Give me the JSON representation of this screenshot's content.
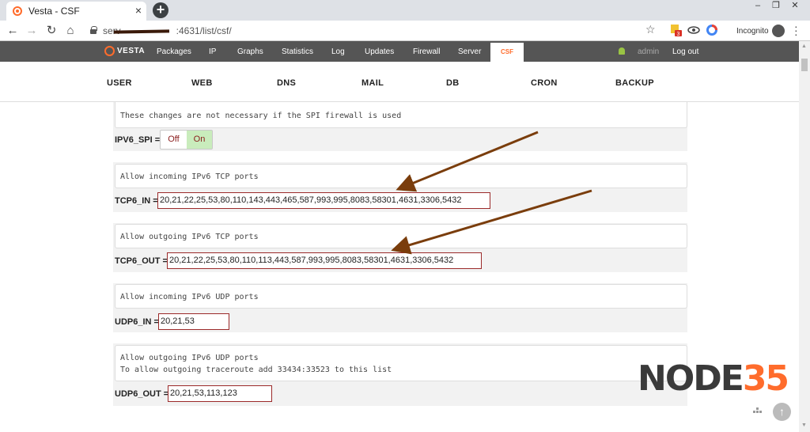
{
  "browser": {
    "tab_title": "Vesta - CSF",
    "tab_close": "×",
    "new_tab": "+",
    "url_prefix": "serv",
    "url_suffix": ":4631/list/csf/",
    "incognito_label": "Incognito",
    "window_controls": [
      "–",
      "❐",
      "✕"
    ],
    "extension_badge": "3"
  },
  "topnav": {
    "logo": "VESTA",
    "items": [
      "Packages",
      "IP",
      "Graphs",
      "Statistics",
      "Log",
      "Updates",
      "Firewall",
      "Server",
      "CSF"
    ],
    "active": "CSF",
    "user": "admin",
    "logout": "Log out"
  },
  "subnav": {
    "items": [
      "USER",
      "WEB",
      "DNS",
      "MAIL",
      "DB",
      "CRON",
      "BACKUP"
    ]
  },
  "config": {
    "spi_comment": "These changes are not necessary if the SPI firewall is used",
    "ipv6_spi": {
      "label": "IPV6_SPI =",
      "off": "Off",
      "on": "On",
      "selected": "On"
    },
    "tcp6_in_comment": "Allow incoming IPv6 TCP ports",
    "tcp6_in": {
      "label": "TCP6_IN =",
      "value": "20,21,22,25,53,80,110,143,443,465,587,993,995,8083,58301,4631,3306,5432"
    },
    "tcp6_out_comment": "Allow outgoing IPv6 TCP ports",
    "tcp6_out": {
      "label": "TCP6_OUT =",
      "value": "20,21,22,25,53,80,110,113,443,587,993,995,8083,58301,4631,3306,5432"
    },
    "udp6_in_comment": "Allow incoming IPv6 UDP ports",
    "udp6_in": {
      "label": "UDP6_IN =",
      "value": "20,21,53"
    },
    "udp6_out_comment": "Allow outgoing IPv6 UDP ports\nTo allow outgoing traceroute add 33434:33523 to this list",
    "udp6_out": {
      "label": "UDP6_OUT =",
      "value": "20,21,53,113,123"
    }
  },
  "watermark": {
    "part_a": "NODE",
    "part_b": "35"
  },
  "colors": {
    "accent": "#ff6c2c",
    "topnav_bg": "#555555",
    "input_border": "#9b2a2a",
    "arrow": "#7a3d0c",
    "toggle_on_bg": "#c9ecbc"
  },
  "icons": [
    "vesta-favicon-icon",
    "back-icon",
    "forward-icon",
    "reload-icon",
    "home-icon",
    "lock-icon",
    "star-icon",
    "incognito-icon",
    "menu-icon",
    "bell-icon",
    "scroll-top-icon"
  ]
}
